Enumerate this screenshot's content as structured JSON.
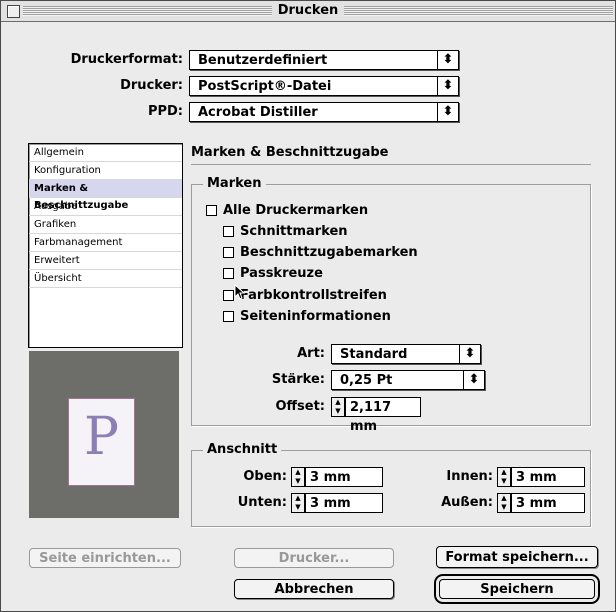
{
  "window": {
    "title": "Drucken"
  },
  "top": {
    "druckerformat_label": "Druckerformat:",
    "druckerformat_value": "Benutzerdefiniert",
    "drucker_label": "Drucker:",
    "drucker_value": "PostScript®-Datei",
    "ppd_label": "PPD:",
    "ppd_value": "Acrobat Distiller"
  },
  "sidebar": {
    "items": [
      {
        "label": "Allgemein"
      },
      {
        "label": "Konfiguration"
      },
      {
        "label": "Marken & Beschnittzugabe"
      },
      {
        "label": "Ausgabe"
      },
      {
        "label": "Grafiken"
      },
      {
        "label": "Farbmanagement"
      },
      {
        "label": "Erweitert"
      },
      {
        "label": "Übersicht"
      }
    ],
    "selected_index": 2
  },
  "preview": {
    "letter": "P"
  },
  "panel": {
    "heading": "Marken & Beschnittzugabe",
    "marken_group": "Marken",
    "checkboxes": {
      "alle": "Alle Druckermarken",
      "schnitt": "Schnittmarken",
      "beschnitt": "Beschnittzugabemarken",
      "pass": "Passkreuze",
      "farb": "Farbkontrollstreifen",
      "seiten": "Seiteninformationen"
    },
    "art_label": "Art:",
    "art_value": "Standard",
    "staerke_label": "Stärke:",
    "staerke_value": "0,25 Pt",
    "offset_label": "Offset:",
    "offset_value": "2,117 mm",
    "anschnitt_group": "Anschnitt",
    "oben_label": "Oben:",
    "oben_value": "3 mm",
    "unten_label": "Unten:",
    "unten_value": "3 mm",
    "innen_label": "Innen:",
    "innen_value": "3 mm",
    "aussen_label": "Außen:",
    "aussen_value": "3 mm"
  },
  "buttons": {
    "seite_einrichten": "Seite einrichten...",
    "drucker": "Drucker...",
    "format_speichern": "Format speichern...",
    "abbrechen": "Abbrechen",
    "speichern": "Speichern"
  },
  "icons": {
    "popup_arrow": "up-down-arrows-icon",
    "stepper": "stepper-arrows-icon",
    "pointer": "mouse-pointer-icon"
  }
}
